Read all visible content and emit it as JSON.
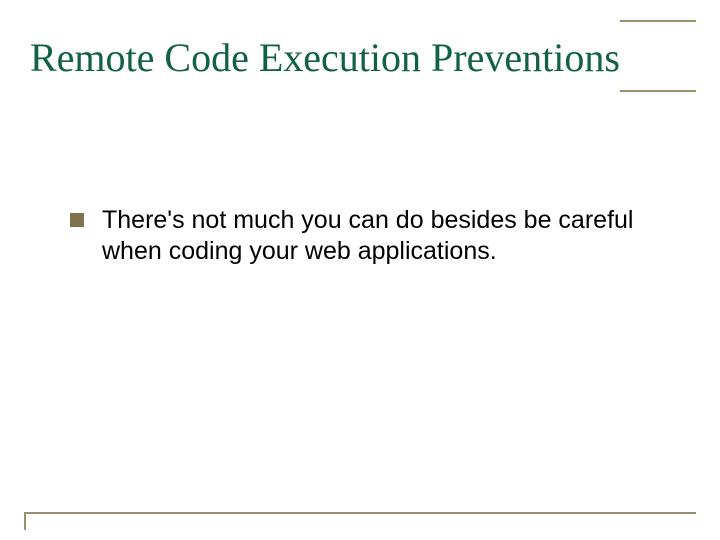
{
  "slide": {
    "title": "Remote Code Execution Preventions",
    "bullets": [
      {
        "text": "There's not much you can do besides be careful when coding your web applications."
      }
    ]
  },
  "colors": {
    "title": "#116144",
    "border": "#9b8e6a",
    "bullet": "#80724c"
  }
}
